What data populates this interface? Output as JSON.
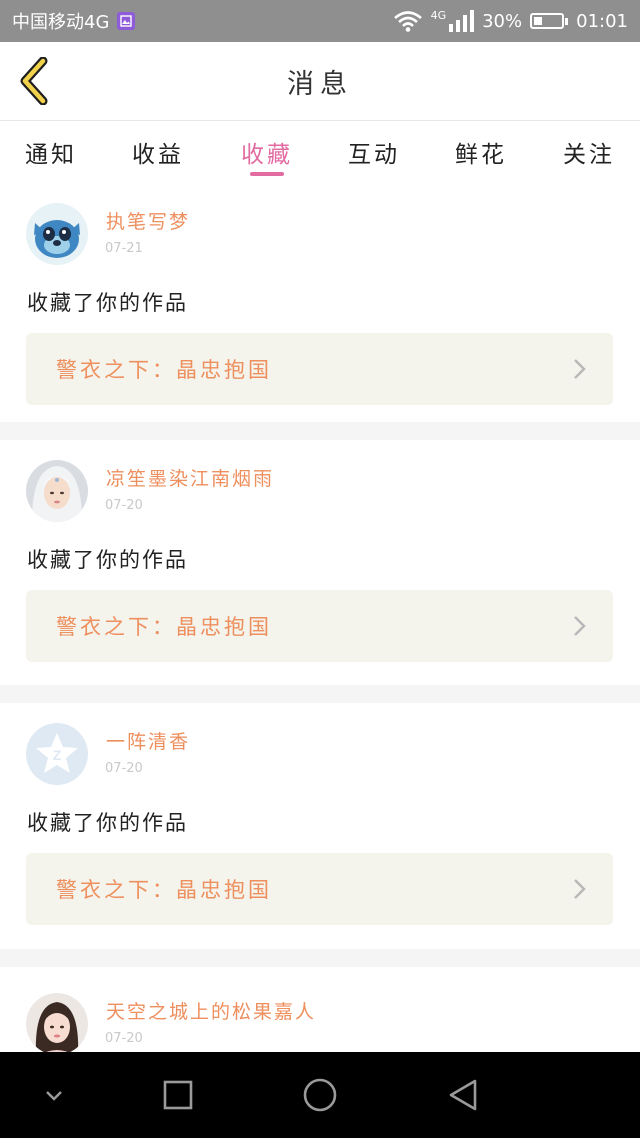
{
  "status_bar": {
    "carrier": "中国移动4G",
    "network_tag": "4G",
    "battery": "30%",
    "battery_level": 0.3,
    "time": "01:01"
  },
  "header": {
    "title": "消息",
    "back_icon": "chevron-left-icon"
  },
  "tabs": {
    "items": [
      "通知",
      "收益",
      "收藏",
      "互动",
      "鲜花",
      "关注"
    ],
    "active_index": 2,
    "active_color": "#e26ba1"
  },
  "messages": [
    {
      "user": "执笔写梦",
      "date": "07-21",
      "action": "收藏了你的作品",
      "work": "警衣之下：晶忠抱国"
    },
    {
      "user": "凉笙墨染江南烟雨",
      "date": "07-20",
      "action": "收藏了你的作品",
      "work": "警衣之下：晶忠抱国"
    },
    {
      "user": "一阵清香",
      "date": "07-20",
      "action": "收藏了你的作品",
      "work": "警衣之下：晶忠抱国"
    },
    {
      "user": "天空之城上的松果嘉人",
      "date": "07-20"
    }
  ],
  "colors": {
    "accent_orange": "#ee8f5e",
    "work_box_bg": "#f4f3ec",
    "status_bar_bg": "#8f8f8f"
  }
}
